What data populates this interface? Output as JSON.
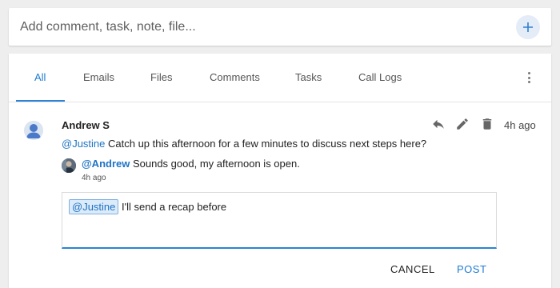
{
  "composer": {
    "placeholder": "Add comment, task, note, file...",
    "add_icon": "plus-icon"
  },
  "tabs": [
    {
      "label": "All",
      "active": true
    },
    {
      "label": "Emails",
      "active": false
    },
    {
      "label": "Files",
      "active": false
    },
    {
      "label": "Comments",
      "active": false
    },
    {
      "label": "Tasks",
      "active": false
    },
    {
      "label": "Call Logs",
      "active": false
    }
  ],
  "more_icon": "more-vertical-icon",
  "comment": {
    "author": "Andrew S",
    "mention": "@Justine",
    "text": " Catch up this afternoon for a few minutes to discuss next steps here?",
    "time": "4h ago",
    "actions": [
      "reply-icon",
      "edit-icon",
      "delete-icon"
    ]
  },
  "reply": {
    "mention": "@Andrew",
    "text": " Sounds good, my afternoon is open.",
    "time": "4h ago"
  },
  "editor": {
    "mention_chip": "@Justine",
    "text": " I'll send a recap before"
  },
  "buttons": {
    "cancel": "CANCEL",
    "post": "POST"
  },
  "colors": {
    "accent": "#1e7bd2",
    "mention": "#1e73c4",
    "background": "#eeeeee"
  }
}
